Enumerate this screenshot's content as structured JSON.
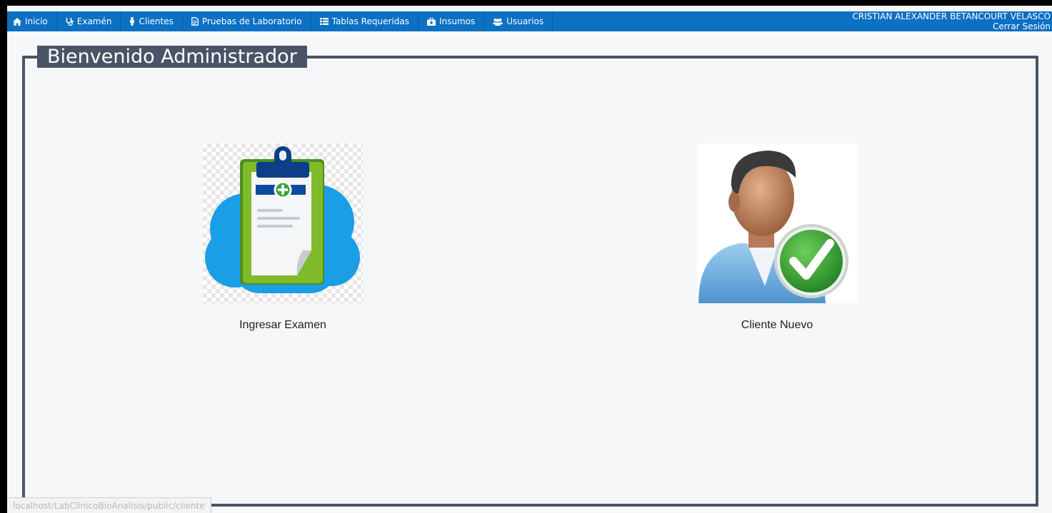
{
  "navbar": {
    "items": [
      {
        "label": "Inicio",
        "icon": "home-icon"
      },
      {
        "label": "Examén",
        "icon": "stethoscope-icon"
      },
      {
        "label": "Clientes",
        "icon": "person-icon"
      },
      {
        "label": "Pruebas de Laboratorio",
        "icon": "document-icon"
      },
      {
        "label": "Tablas Requeridas",
        "icon": "table-list-icon"
      },
      {
        "label": "Insumos",
        "icon": "medkit-icon"
      },
      {
        "label": "Usuarios",
        "icon": "users-icon"
      }
    ],
    "user_name": "CRISTIAN ALEXANDER BETANCOURT VELASCO",
    "logout_label": "Cerrar Sesión"
  },
  "main": {
    "legend": "Bienvenido Administrador",
    "cards": [
      {
        "label": "Ingresar Examen",
        "icon": "clipboard-cloud-icon"
      },
      {
        "label": "Cliente Nuevo",
        "icon": "user-check-icon"
      }
    ]
  },
  "status_bar": {
    "url": "localhost/LabClinicoBioAnalisis/public/cliente"
  },
  "colors": {
    "navbar": "#0c70c3",
    "fieldset_border": "#4a5466",
    "page_background": "#f5f7f9"
  }
}
